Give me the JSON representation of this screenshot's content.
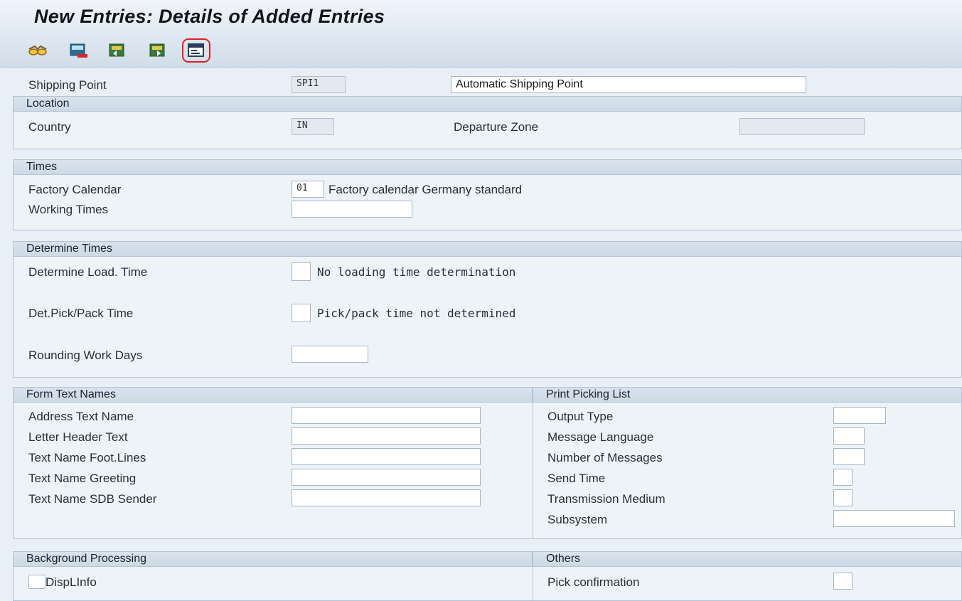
{
  "screen": {
    "title": "New Entries: Details of Added Entries"
  },
  "toolbar": {
    "buttons": [
      {
        "name": "glasses-icon"
      },
      {
        "name": "delete-entry-icon"
      },
      {
        "name": "previous-entry-icon"
      },
      {
        "name": "next-entry-icon"
      },
      {
        "name": "info-icon"
      }
    ]
  },
  "header": {
    "shipping_point_label": "Shipping Point",
    "shipping_point_value": "SPI1",
    "shipping_point_desc": "Automatic Shipping Point"
  },
  "location": {
    "title": "Location",
    "country_label": "Country",
    "country_value": "IN",
    "departure_zone_label": "Departure Zone",
    "departure_zone_value": ""
  },
  "times": {
    "title": "Times",
    "factory_calendar_label": "Factory Calendar",
    "factory_calendar_value": "01",
    "factory_calendar_desc": "Factory calendar Germany standard",
    "working_times_label": "Working Times",
    "working_times_value": ""
  },
  "determine_times": {
    "title": "Determine Times",
    "load_time_label": "Determine Load. Time",
    "load_time_desc": "No loading time determination",
    "pick_pack_label": "Det.Pick/Pack Time",
    "pick_pack_desc": "Pick/pack time not determined",
    "rounding_label": "Rounding Work Days",
    "rounding_value": ""
  },
  "form_text_names": {
    "title": "Form Text Names",
    "fields": [
      {
        "label": "Address Text Name",
        "value": ""
      },
      {
        "label": "Letter Header Text",
        "value": ""
      },
      {
        "label": "Text Name Foot.Lines",
        "value": ""
      },
      {
        "label": "Text Name Greeting",
        "value": ""
      },
      {
        "label": "Text Name SDB Sender",
        "value": ""
      }
    ]
  },
  "print_picking_list": {
    "title": "Print Picking List",
    "fields": [
      {
        "label": "Output Type",
        "value": ""
      },
      {
        "label": "Message Language",
        "value": ""
      },
      {
        "label": "Number of Messages",
        "value": ""
      },
      {
        "label": "Send Time",
        "value": ""
      },
      {
        "label": "Transmission Medium",
        "value": ""
      },
      {
        "label": "Subsystem",
        "value": ""
      }
    ]
  },
  "background_processing": {
    "title": "Background Processing",
    "displinfo_label": "DispLInfo"
  },
  "others": {
    "title": "Others",
    "pick_confirmation_label": "Pick confirmation"
  }
}
